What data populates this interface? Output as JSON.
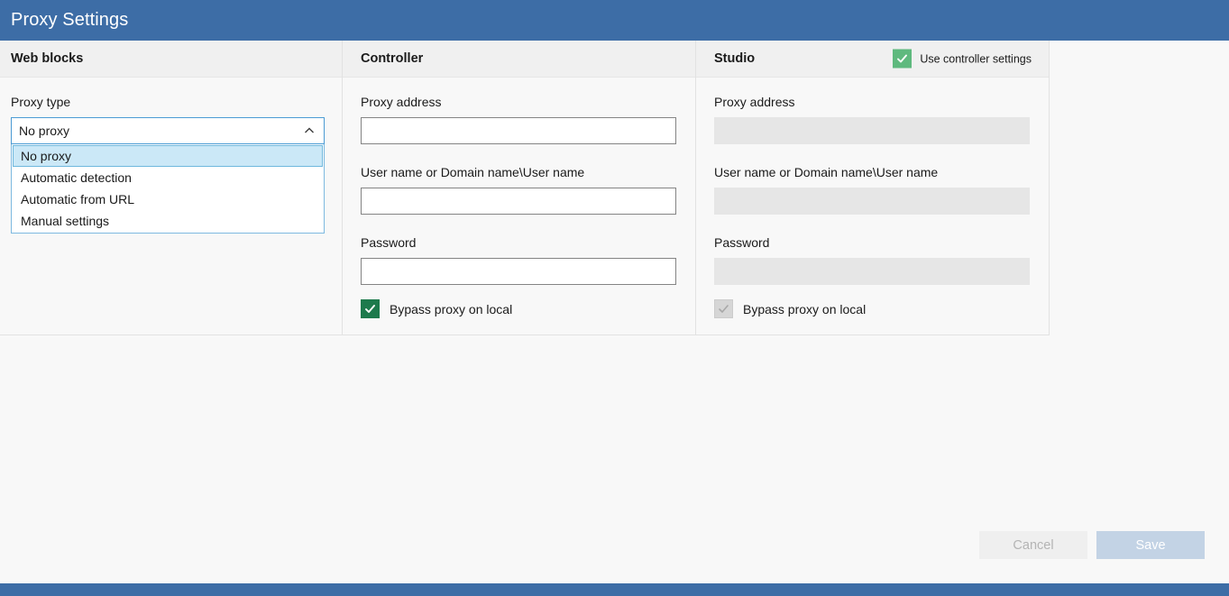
{
  "window": {
    "title": "Proxy Settings",
    "titlebar_color": "#3d6da6",
    "statusbar_color": "#3d6da6"
  },
  "columns": {
    "web_blocks": {
      "header": "Web blocks",
      "proxy_type_label": "Proxy type",
      "proxy_type_value": "No proxy",
      "proxy_type_options": [
        "No proxy",
        "Automatic detection",
        "Automatic from URL",
        "Manual settings"
      ],
      "selected_option_index": 0,
      "dropdown_open": true,
      "chevron": "chevron-up-icon"
    },
    "controller": {
      "header": "Controller",
      "proxy_address_label": "Proxy address",
      "proxy_address_value": "",
      "user_name_label": "User name or Domain name\\User name",
      "user_name_value": "",
      "password_label": "Password",
      "password_value": "",
      "bypass_label": "Bypass proxy on local",
      "bypass_checked": true,
      "bypass_color": "#1d7a4c",
      "enabled": true
    },
    "studio": {
      "header": "Studio",
      "use_controller_settings_label": "Use controller settings",
      "use_controller_settings_checked": true,
      "use_controller_settings_color": "#5fb97e",
      "proxy_address_label": "Proxy address",
      "proxy_address_value": "",
      "user_name_label": "User name or Domain name\\User name",
      "user_name_value": "",
      "password_label": "Password",
      "password_value": "",
      "bypass_label": "Bypass proxy on local",
      "bypass_checked": true,
      "bypass_color": "#d6d6d6",
      "enabled": false
    }
  },
  "footer": {
    "cancel_label": "Cancel",
    "save_label": "Save",
    "cancel_enabled": false,
    "save_enabled": false
  }
}
